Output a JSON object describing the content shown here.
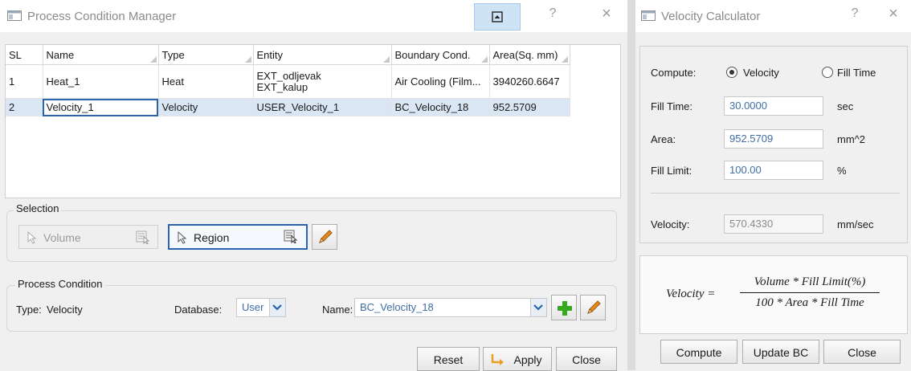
{
  "pcm": {
    "title": "Process Condition Manager",
    "help_glyph": "?",
    "close_glyph": "×",
    "columns": [
      "SL",
      "Name",
      "Type",
      "Entity",
      "Boundary Cond.",
      "Area(Sq. mm)"
    ],
    "rows": [
      {
        "sl": "1",
        "name": "Heat_1",
        "type": "Heat",
        "entity_lines": [
          "EXT_odljevak",
          "EXT_kalup"
        ],
        "bc": "Air Cooling (Film...",
        "area": "3940260.6647"
      },
      {
        "sl": "2",
        "name": "Velocity_1",
        "type": "Velocity",
        "entity_lines": [
          "USER_Velocity_1"
        ],
        "bc": "BC_Velocity_18",
        "area": "952.5709"
      }
    ],
    "selection": {
      "label": "Selection",
      "volume_label": "Volume",
      "region_label": "Region"
    },
    "process_condition": {
      "label": "Process Condition",
      "type_label": "Type:",
      "type_value": "Velocity",
      "database_label": "Database:",
      "database_value": "User",
      "name_label": "Name:",
      "name_value": "BC_Velocity_18"
    },
    "buttons": {
      "reset": "Reset",
      "apply": "Apply",
      "close": "Close"
    }
  },
  "vc": {
    "title": "Velocity Calculator",
    "help_glyph": "?",
    "close_glyph": "×",
    "compute_label": "Compute:",
    "radio_velocity": "Velocity",
    "radio_fill_time": "Fill Time",
    "radio_selected": "velocity",
    "fill_time_label": "Fill Time:",
    "fill_time_value": "30.0000",
    "fill_time_unit": "sec",
    "area_label": "Area:",
    "area_value": "952.5709",
    "area_unit": "mm^2",
    "fill_limit_label": "Fill Limit:",
    "fill_limit_value": "100.00",
    "fill_limit_unit": "%",
    "velocity_label": "Velocity:",
    "velocity_value": "570.4330",
    "velocity_unit": "mm/sec",
    "formula_lhs": "Velocity =",
    "formula_numerator": "Volume * Fill Limit(%)",
    "formula_denominator": "100 * Area * Fill Time",
    "buttons": {
      "compute": "Compute",
      "update_bc": "Update BC",
      "close": "Close"
    }
  },
  "colors": {
    "accent_blue": "#3f6ea5",
    "selection_row": "#dbe6f4",
    "active_cell_border": "#2a64b0",
    "plus_green": "#38a81f",
    "pencil_orange": "#e8891c",
    "apply_arrow": "#e8a020"
  },
  "icons": [
    "app-window-icon",
    "restore-icon",
    "help-icon",
    "close-icon",
    "pointer-icon",
    "select-list-icon",
    "pencil-icon",
    "plus-icon",
    "apply-arrow-icon",
    "dropdown-chevron-icon"
  ]
}
